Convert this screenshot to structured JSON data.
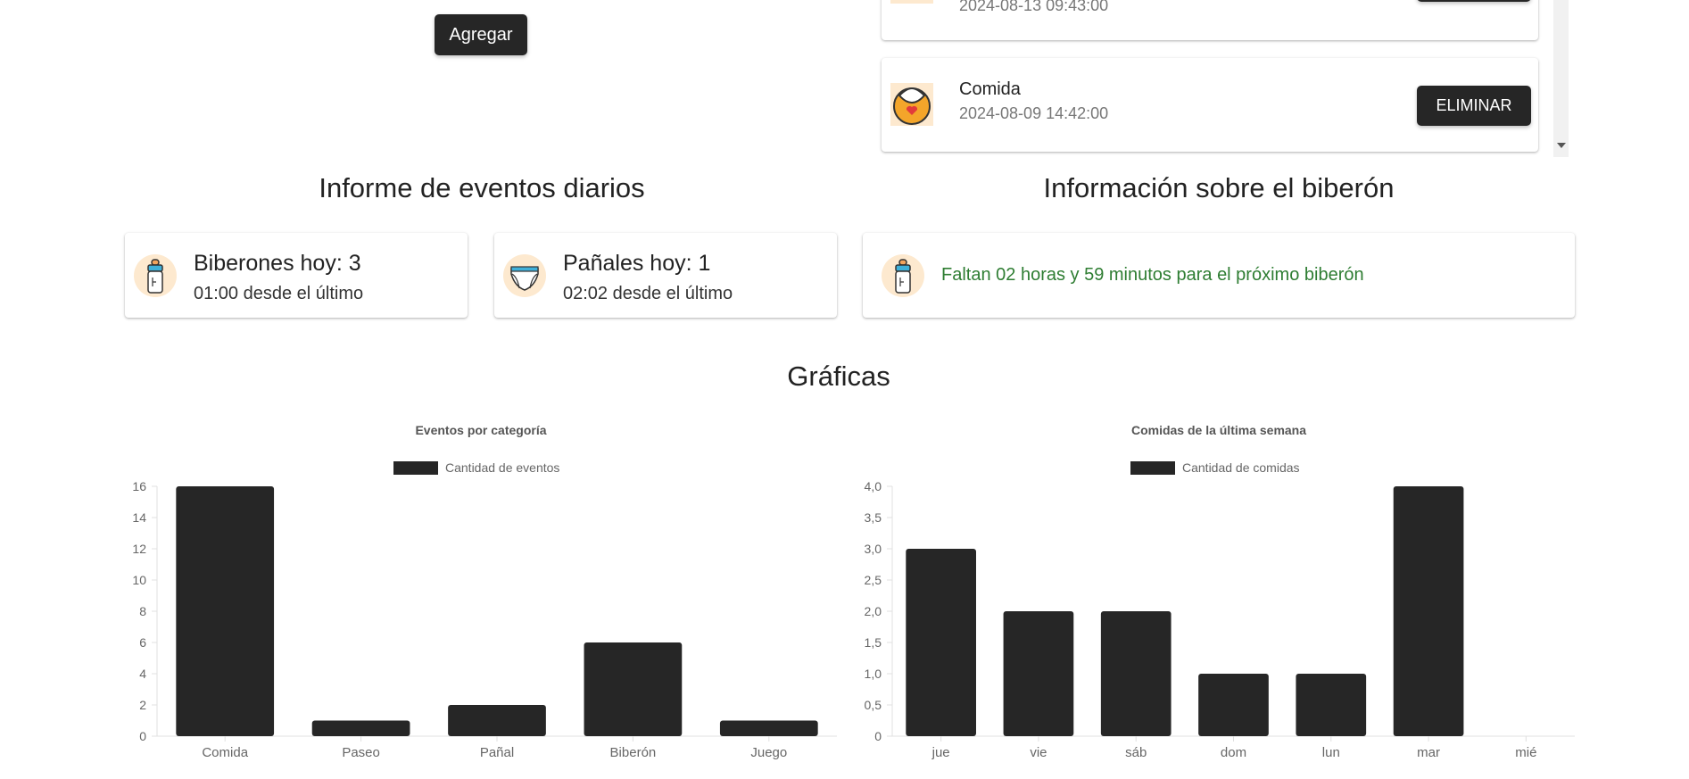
{
  "add_form": {
    "add_label": "Agregar"
  },
  "event_list": {
    "items": [
      {
        "name": "",
        "datetime": "2024-08-13 09:43:00",
        "delete_label": ""
      },
      {
        "name": "Comida",
        "datetime": "2024-08-09 14:42:00",
        "delete_label": "ELIMINAR"
      }
    ]
  },
  "daily_report": {
    "title": "Informe de eventos diarios",
    "bottles": {
      "count_text": "Biberones hoy: 3",
      "since_text": "01:00 desde el último",
      "icon": "baby-bottle-icon"
    },
    "diapers": {
      "count_text": "Pañales hoy: 1",
      "since_text": "02:02 desde el último",
      "icon": "diaper-icon"
    }
  },
  "bottle_info": {
    "title": "Información sobre el biberón",
    "message": "Faltan 02 horas y 59 minutos para el próximo biberón",
    "message_color": "#2e7d32",
    "icon": "baby-bottle-icon"
  },
  "charts_section": {
    "title": "Gráficas"
  },
  "chart_data": [
    {
      "type": "bar",
      "title": "Eventos por categoría",
      "categories": [
        "Comida",
        "Paseo",
        "Pañal",
        "Biberón",
        "Juego"
      ],
      "series": [
        {
          "name": "Cantidad de eventos",
          "values": [
            16,
            1,
            2,
            6,
            1
          ]
        }
      ],
      "ylim": [
        0,
        16
      ],
      "yticks": [
        "0",
        "2",
        "4",
        "6",
        "8",
        "10",
        "12",
        "14",
        "16"
      ],
      "grid": false,
      "legend": "top-center",
      "bar_color": "#262626"
    },
    {
      "type": "bar",
      "title": "Comidas de la última semana",
      "categories": [
        "jue",
        "vie",
        "sáb",
        "dom",
        "lun",
        "mar",
        "mié"
      ],
      "series": [
        {
          "name": "Cantidad de comidas",
          "values": [
            3,
            2,
            2,
            1,
            1,
            4,
            0
          ]
        }
      ],
      "ylim": [
        0,
        4
      ],
      "yticks": [
        "0",
        "0,5",
        "1,0",
        "1,5",
        "2,0",
        "2,5",
        "3,0",
        "3,5",
        "4,0"
      ],
      "grid": false,
      "legend": "top-center",
      "bar_color": "#262626"
    }
  ]
}
